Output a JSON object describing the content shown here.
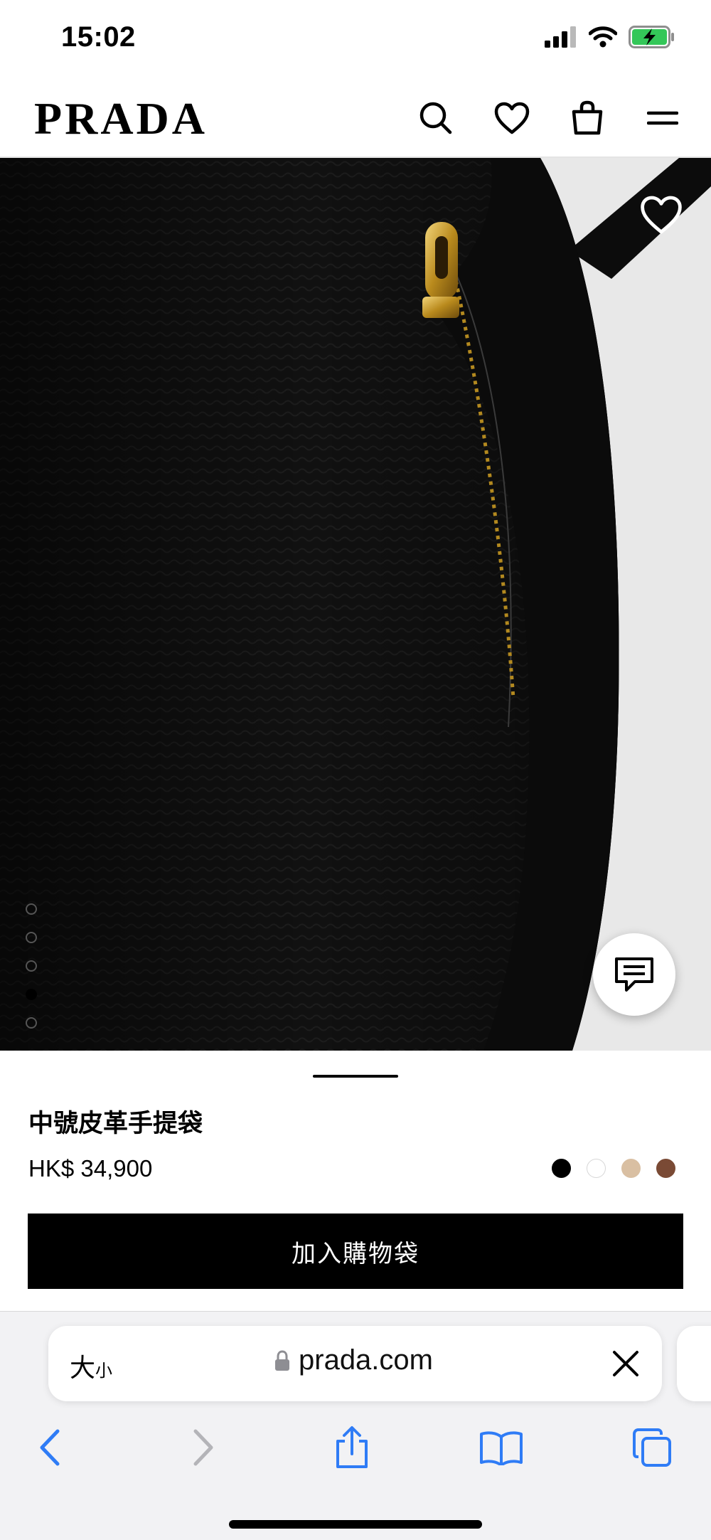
{
  "status_bar": {
    "time": "15:02",
    "icons": [
      "signal-icon",
      "wifi-icon",
      "battery-charging-icon"
    ],
    "battery_color": "#34c759"
  },
  "header": {
    "logo": "PRADA",
    "icons": [
      "search-icon",
      "heart-icon",
      "shopping-bag-icon",
      "menu-icon"
    ]
  },
  "gallery": {
    "image_count": 5,
    "active_index": 4,
    "icons": [
      "heart-icon",
      "chat-icon"
    ]
  },
  "product": {
    "title": "中號皮革手提袋",
    "price": "HK$ 34,900",
    "colors": [
      "#000000",
      "#ffffff",
      "#d9bfa2",
      "#7a4a35"
    ],
    "add_to_bag_label": "加入購物袋"
  },
  "browser": {
    "text_size_big": "大",
    "text_size_small": "小",
    "url": "prada.com",
    "accent": "#2f7cf6",
    "toolbar_icons": [
      "back-icon",
      "forward-icon",
      "share-icon",
      "bookmarks-icon",
      "tabs-icon"
    ]
  }
}
